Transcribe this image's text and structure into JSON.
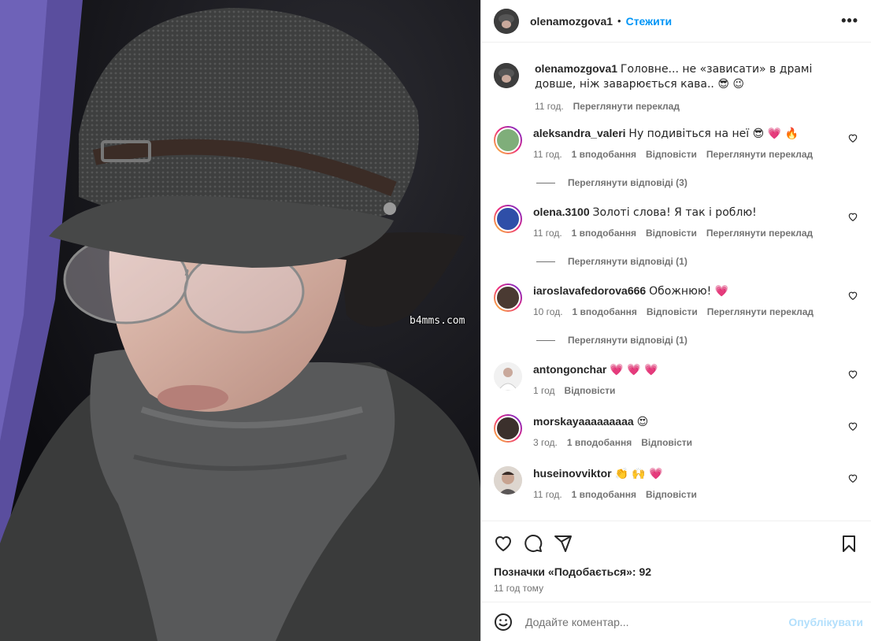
{
  "post": {
    "author": "olenamozgova1",
    "follow_label": "Стежити",
    "more_label": "•••",
    "watermark": "b4mms.com"
  },
  "caption": {
    "username": "olenamozgova1",
    "text": "Головне... не «зависати» в драмі довше, ніж заварюється кава.. 😎 😉",
    "time": "11 год.",
    "translate_label": "Переглянути переклад"
  },
  "comments": [
    {
      "username": "aleksandra_valeri",
      "text": "Ну подивіться на неї 😎 💗 🔥",
      "time": "11 год.",
      "likes": "1 вподобання",
      "reply": "Відповісти",
      "translate": "Переглянути переклад",
      "replies": "Переглянути відповіді (3)"
    },
    {
      "username": "olena.3100",
      "text": "Золоті слова! Я так і роблю!",
      "time": "11 год.",
      "likes": "1 вподобання",
      "reply": "Відповісти",
      "translate": "Переглянути переклад",
      "replies": "Переглянути відповіді (1)"
    },
    {
      "username": "iaroslavafedorova666",
      "text": "Обожнюю! 💗",
      "time": "10 год.",
      "likes": "1 вподобання",
      "reply": "Відповісти",
      "translate": "Переглянути переклад",
      "replies": "Переглянути відповіді (1)"
    },
    {
      "username": "antongonchar",
      "text": "💗 💗 💗",
      "time": "1 год",
      "likes": "",
      "reply": "Відповісти",
      "translate": "",
      "replies": ""
    },
    {
      "username": "morskayaaaaaaaaa",
      "text": "😍",
      "time": "3 год.",
      "likes": "1 вподобання",
      "reply": "Відповісти",
      "translate": "",
      "replies": ""
    },
    {
      "username": "huseinovviktor",
      "text": "👏 🙌 💗",
      "time": "11 год.",
      "likes": "1 вподобання",
      "reply": "Відповісти",
      "translate": "",
      "replies": ""
    }
  ],
  "footer": {
    "likes_text": "Позначки «Подобається»: 92",
    "time_ago": "11 год тому",
    "comment_placeholder": "Додайте коментар...",
    "post_label": "Опублікувати"
  },
  "colors": {
    "accent": "#0095f6",
    "post_disabled": "#b2dffc",
    "muted": "#737373"
  }
}
